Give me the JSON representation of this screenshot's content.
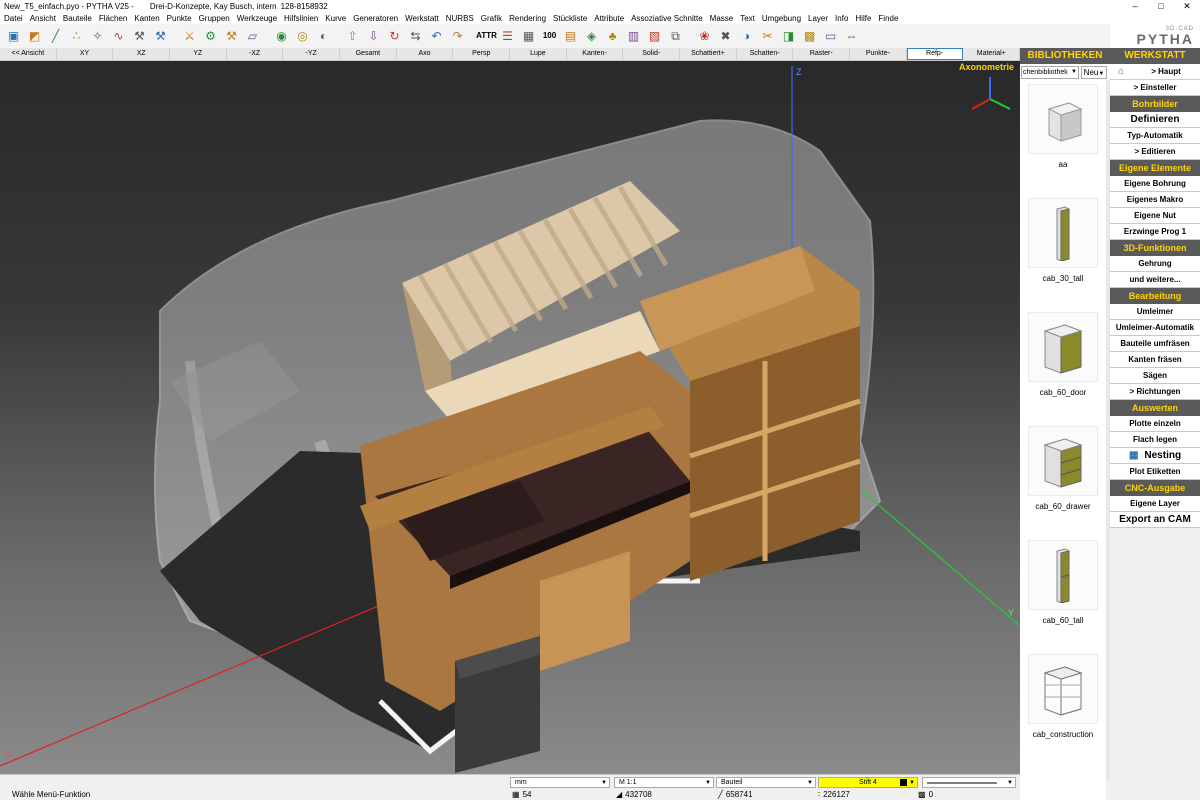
{
  "window": {
    "title": "New_T5_einfach.pyo - PYTHA V25 -",
    "project": "Drei-D-Konzepte, Kay Busch, intern",
    "license": "128-8158932",
    "controls": [
      "–",
      "□",
      "✕"
    ]
  },
  "menu": [
    "Datei",
    "Ansicht",
    "Bauteile",
    "Flächen",
    "Kanten",
    "Punkte",
    "Gruppen",
    "Werkzeuge",
    "Hilfslinien",
    "Kurve",
    "Generatoren",
    "Werkstatt",
    "NURBS",
    "Grafik",
    "Rendering",
    "Stückliste",
    "Attribute",
    "Assoziative Schnitte",
    "Masse",
    "Text",
    "Umgebung",
    "Layer",
    "Info",
    "Hilfe",
    "Finde"
  ],
  "toolbar": {
    "groups": [
      [
        "cube-icon",
        "extrude-icon",
        "polyline-icon",
        "points-icon",
        "symbol-icon",
        "curve-icon",
        "hammer-icon",
        "wrench-icon"
      ],
      [
        "saw-icon",
        "router-icon",
        "drill-icon",
        "plane-icon"
      ],
      [
        "camera-icon",
        "eye-icon",
        "render-icon"
      ],
      [
        "upload-icon",
        "download-icon",
        "rotate-icon",
        "mirror-icon",
        "undo-icon",
        "redo-icon"
      ],
      [
        "attr-icon",
        "list-icon",
        "table-icon",
        "num-icon",
        "sheet-icon",
        "layers-icon",
        "tree-icon",
        "panel-icon",
        "stack-icon",
        "copy-icon"
      ],
      [
        "color-icon",
        "delete-icon",
        "boolean-icon",
        "cut-icon",
        "merge-icon",
        "wood-icon",
        "edge-icon",
        "dims-icon"
      ]
    ],
    "attr_text": "ATTR",
    "num_text": "100"
  },
  "logo": {
    "small": "3D·CAD",
    "big": "PYTHA"
  },
  "views": [
    "<< Ansicht",
    "XY",
    "XZ",
    "YZ",
    "-XZ",
    "-YZ",
    "Gesamt",
    "Axo",
    "Persp",
    "Lupe",
    "Kanten-",
    "Solid-",
    "Schattiert+",
    "Schatten-",
    "Raster-",
    "Punkte-",
    "Refp-",
    "Material+"
  ],
  "active_view": "Refp-",
  "viewport": {
    "label": "Axonometrie",
    "axes": {
      "x": "X",
      "y": "Y",
      "z": "Z"
    }
  },
  "library": {
    "header": "BIBLIOTHEKEN",
    "select_value": "chenbibliothek",
    "new_button": "Neu",
    "items": [
      {
        "name": "aa"
      },
      {
        "name": "cab_30_tall"
      },
      {
        "name": "cab_60_door"
      },
      {
        "name": "cab_60_drawer"
      },
      {
        "name": "cab_60_tall"
      },
      {
        "name": "cab_construction"
      }
    ]
  },
  "workshop": {
    "header": "WERKSTATT",
    "haupt": "> Haupt",
    "entries": [
      {
        "type": "btn",
        "label": "> Einsteller"
      },
      {
        "type": "sec",
        "label": "Bohrbilder"
      },
      {
        "type": "btn",
        "label": "Definieren",
        "big": true
      },
      {
        "type": "btn",
        "label": "Typ-Automatik"
      },
      {
        "type": "btn",
        "label": "> Editieren"
      },
      {
        "type": "sec",
        "label": "Eigene Elemente"
      },
      {
        "type": "btn",
        "label": "Eigene Bohrung"
      },
      {
        "type": "btn",
        "label": "Eigenes Makro"
      },
      {
        "type": "btn",
        "label": "Eigene Nut"
      },
      {
        "type": "btn",
        "label": "Erzwinge Prog 1"
      },
      {
        "type": "sec",
        "label": "3D-Funktionen"
      },
      {
        "type": "btn",
        "label": "Gehrung"
      },
      {
        "type": "btn",
        "label": "und weitere..."
      },
      {
        "type": "sec",
        "label": "Bearbeitung"
      },
      {
        "type": "btn",
        "label": "Umleimer"
      },
      {
        "type": "btn",
        "label": "Umleimer-Automatik"
      },
      {
        "type": "btn",
        "label": "Bauteile umfräsen"
      },
      {
        "type": "btn",
        "label": "Kanten fräsen"
      },
      {
        "type": "btn",
        "label": "Sägen"
      },
      {
        "type": "btn",
        "label": "> Richtungen"
      },
      {
        "type": "sec",
        "label": "Auswerten"
      },
      {
        "type": "btn",
        "label": "Plotte einzeln"
      },
      {
        "type": "btn",
        "label": "Flach legen"
      },
      {
        "type": "btn",
        "label": "Nesting",
        "big": true,
        "icon": true
      },
      {
        "type": "btn",
        "label": "Plot Etiketten"
      },
      {
        "type": "sec",
        "label": "CNC-Ausgabe"
      },
      {
        "type": "btn",
        "label": "Eigene Layer"
      },
      {
        "type": "btn",
        "label": "Export an CAM",
        "big": true
      }
    ]
  },
  "status": {
    "message": "Wähle Menü-Funktion",
    "unit": "mm",
    "scale": "M 1:1",
    "mode": "Bauteil",
    "pen": "Stift 4",
    "parts": "54",
    "faces": "432708",
    "edges": "658741",
    "points": "226127",
    "groups": "0"
  }
}
